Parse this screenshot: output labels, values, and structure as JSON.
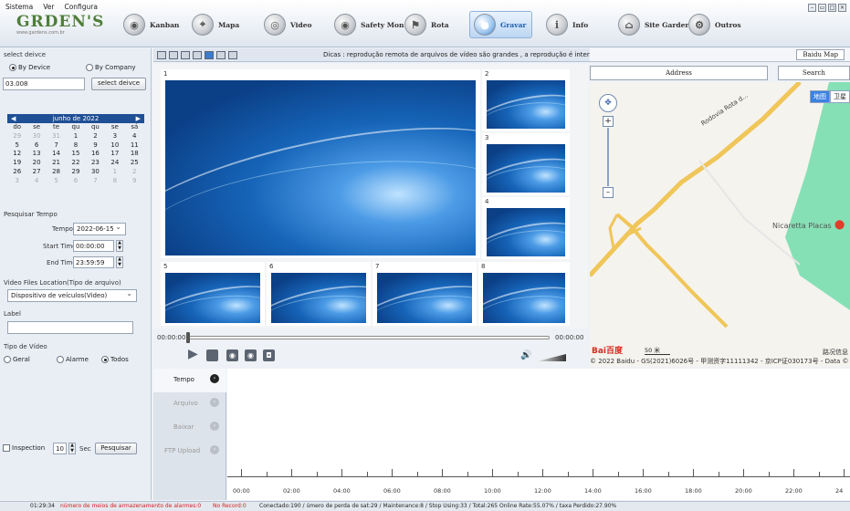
{
  "menu": [
    "Sistema",
    "Ver",
    "Configura"
  ],
  "logo": {
    "brand": "GRDEN'S",
    "sub": "www.gardens.com.br"
  },
  "nav": [
    {
      "label": "Kanban",
      "icon": "steering-wheel-icon"
    },
    {
      "label": "Mapa",
      "icon": "map-icon"
    },
    {
      "label": "Video",
      "icon": "camera-icon"
    },
    {
      "label": "Safety Mon",
      "icon": "steering-wheel-icon"
    },
    {
      "label": "Rota",
      "icon": "route-icon"
    },
    {
      "label": "Gravar",
      "icon": "record-icon"
    },
    {
      "label": "Info",
      "icon": "info-icon"
    },
    {
      "label": "Site Garder",
      "icon": "site-icon"
    },
    {
      "label": "Outros",
      "icon": "other-icon"
    }
  ],
  "left": {
    "select_title": "select deivce",
    "by_device": "By Device",
    "by_company": "By Company",
    "device_value": "03.008",
    "select_button": "select deivce",
    "calendar": {
      "month": "junho de 2022",
      "dow": [
        "do",
        "se",
        "te",
        "qu",
        "qu",
        "se",
        "sá"
      ],
      "days": [
        "29",
        "30",
        "31",
        "1",
        "2",
        "3",
        "4",
        "5",
        "6",
        "7",
        "8",
        "9",
        "10",
        "11",
        "12",
        "13",
        "14",
        "15",
        "16",
        "17",
        "18",
        "19",
        "20",
        "21",
        "22",
        "23",
        "24",
        "25",
        "26",
        "27",
        "28",
        "29",
        "30",
        "1",
        "2",
        "3",
        "4",
        "5",
        "6",
        "7",
        "8",
        "9"
      ]
    },
    "search_time_title": "Pesquisar Tempo",
    "tempo_label": "Tempo",
    "tempo_value": "2022-06-15",
    "start_label": "Start Time",
    "start_value": "00:00:00",
    "end_label": "End Time",
    "end_value": "23:59:59",
    "files_title": "Video Files Location(Tipo de arquivo)",
    "files_value": "Dispositivo de veículos(Video)",
    "label_title": "Label",
    "label_value": "",
    "type_title": "Tipo de Vídeo",
    "type_geral": "Geral",
    "type_alarme": "Alarme",
    "type_todos": "Todos",
    "inspection_label": "Inspection",
    "inspection_value": "10",
    "sec_label": "Sec",
    "search_button": "Pesquisar"
  },
  "center": {
    "tip": "Dicas : reprodução remota de arquivos de vídeo são grandes , a reprodução é interrompida.",
    "cells": [
      "1",
      "2",
      "3",
      "4",
      "5",
      "6",
      "7",
      "8"
    ],
    "time_start": "00:00:00",
    "time_end": "00:00:00"
  },
  "map": {
    "tab": "Baidu Map",
    "address_label": "Address",
    "search_label": "Search",
    "toggle": [
      "地图",
      "卫星"
    ],
    "road": "Rodovia Rota d...",
    "place": "Nicaretta Placas",
    "scale": "50 米",
    "copyright": "© 2022 Baidu - GS(2021)6026号 - 甲测资字11111342 - 京ICP证030173号 - Data ©",
    "road_info": "路况信息",
    "baidu": "Bai百度"
  },
  "timeline": {
    "tabs": [
      "Tempo",
      "Arquivo",
      "Baixar",
      "FTP Upload"
    ],
    "hours": [
      "00:00",
      "02:00",
      "04:00",
      "06:00",
      "08:00",
      "10:00",
      "12:00",
      "14:00",
      "16:00",
      "18:00",
      "20:00",
      "22:00",
      "24"
    ]
  },
  "status": {
    "time": "01:29:34",
    "alert": "número de meios de armazenamento de alarmes:0",
    "norecord": "No Record:0",
    "stats": "Conectado:190 / úmero de perda de sat:29 / Maintenance:8 / Stop Using:33 / Total:265   Online Rate:55.07% / taxa Perdido:27.90%"
  },
  "colors": {
    "accent": "#1f4f95",
    "alert": "#d02020",
    "map_green": "#86e0b6",
    "road_yellow": "#f5cf6a"
  }
}
